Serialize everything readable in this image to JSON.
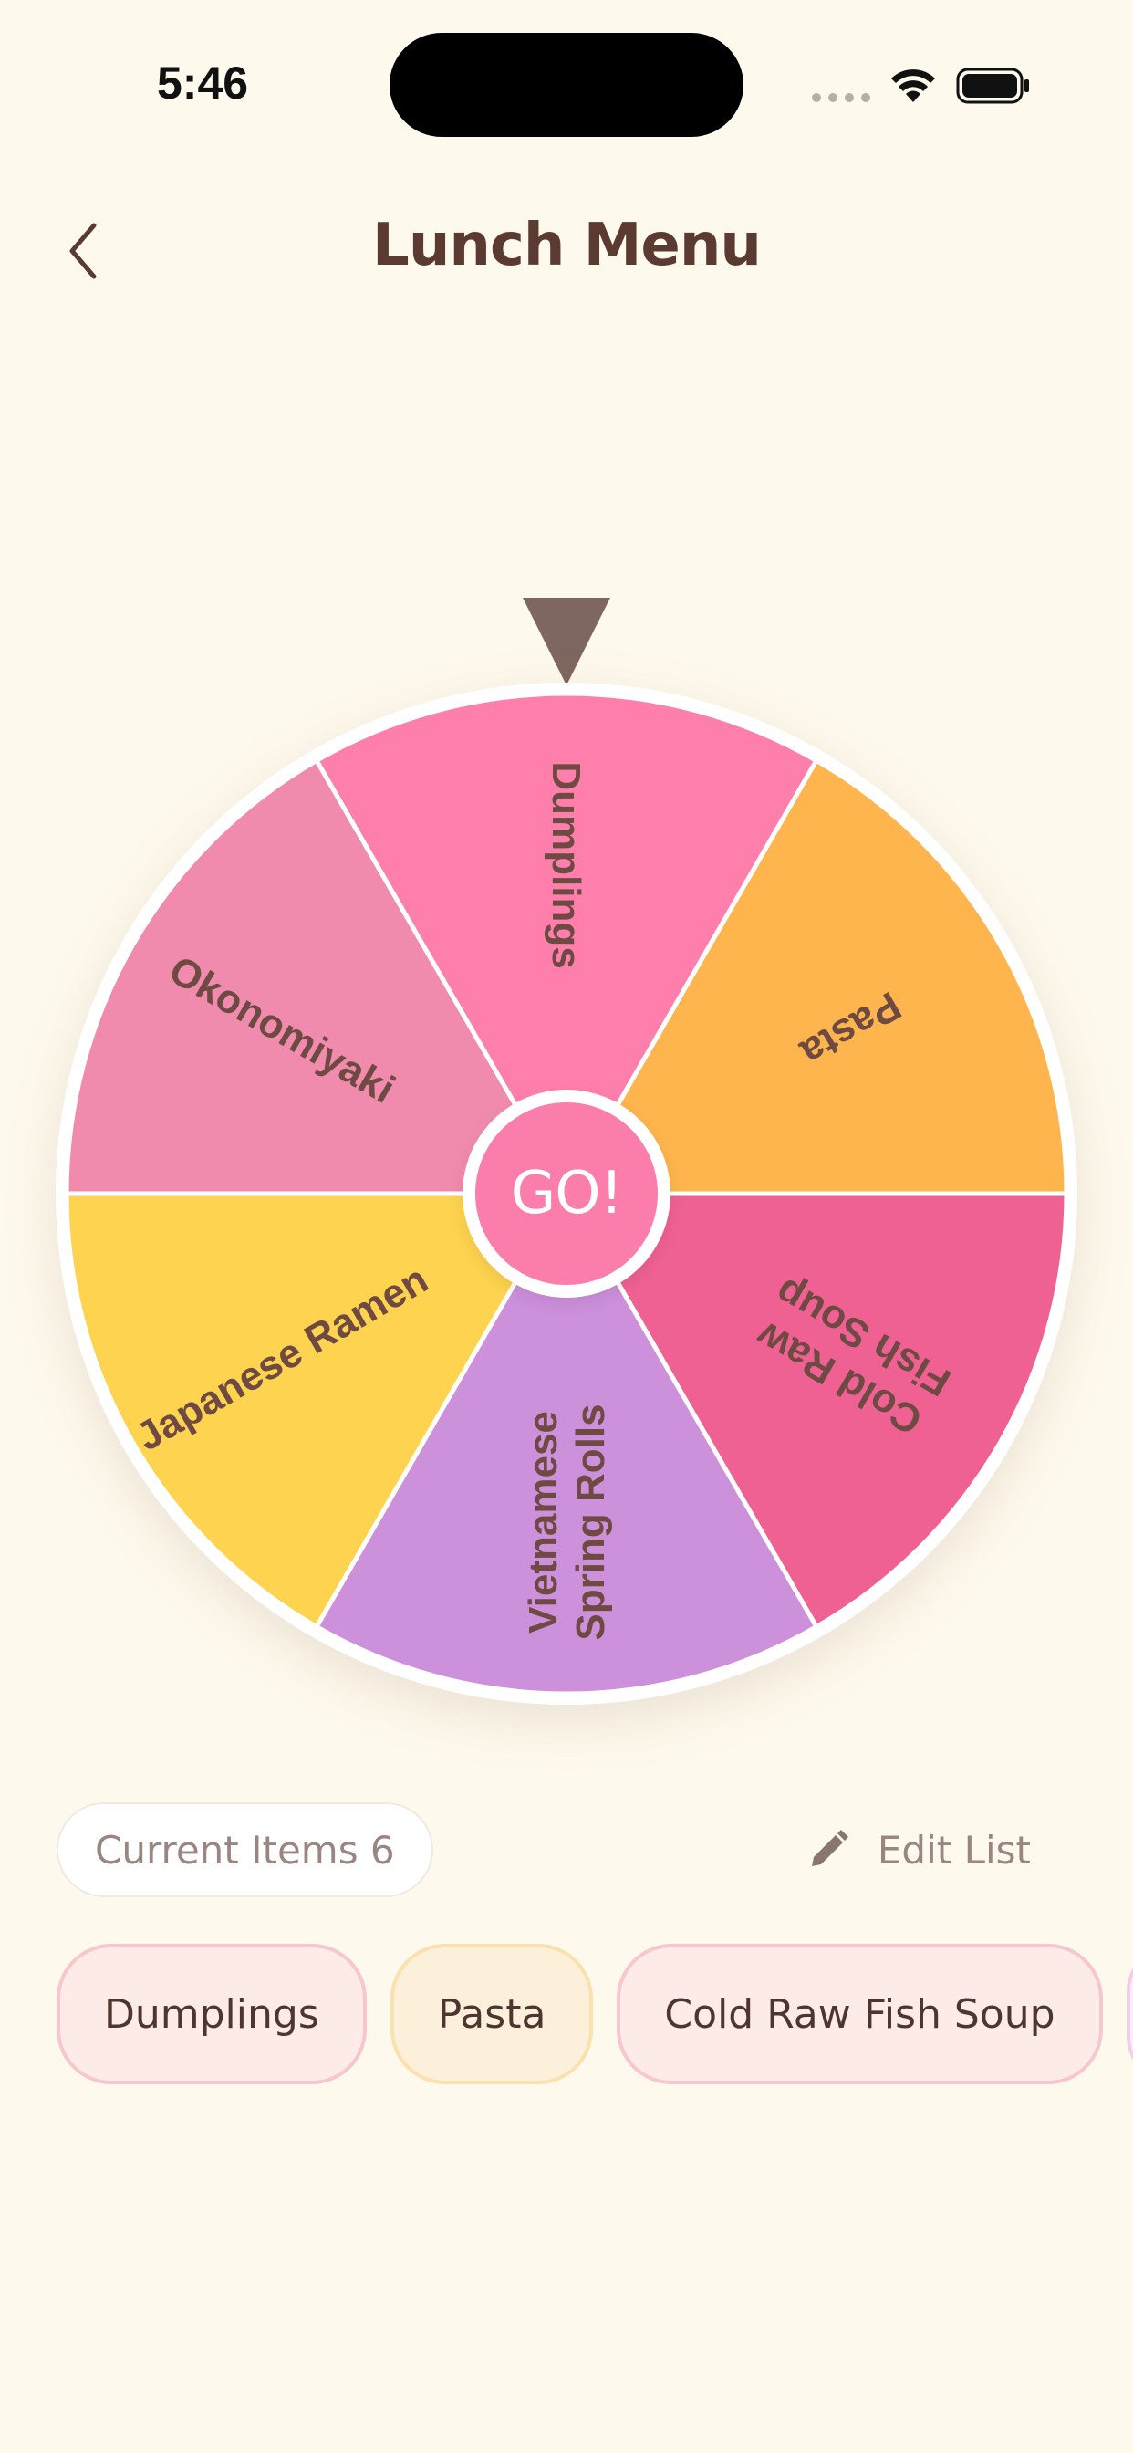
{
  "status_bar": {
    "time": "5:46"
  },
  "header": {
    "title": "Lunch Menu",
    "back_icon": "chevron-left-icon"
  },
  "wheel": {
    "pointer_color": "#7E6760",
    "segments": [
      {
        "label": "Dumplings",
        "color": "#FE7FAB"
      },
      {
        "label": "Pasta",
        "color": "#FEB54D"
      },
      {
        "label": "Cold Raw Fish Soup",
        "color": "#F06193"
      },
      {
        "label": "Vietnamese Spring Rolls",
        "color": "#CD90DB"
      },
      {
        "label": "Japanese Ramen",
        "color": "#FED34F"
      },
      {
        "label": "Okonomiyaki",
        "color": "#F18BAD"
      }
    ],
    "go_label": "GO!"
  },
  "info": {
    "current_items_label": "Current Items 6",
    "edit_list_label": "Edit List",
    "edit_icon": "pencil-icon"
  },
  "chips": [
    {
      "label": "Dumplings"
    },
    {
      "label": "Pasta"
    },
    {
      "label": "Cold Raw Fish Soup"
    },
    {
      "label": ""
    }
  ]
}
